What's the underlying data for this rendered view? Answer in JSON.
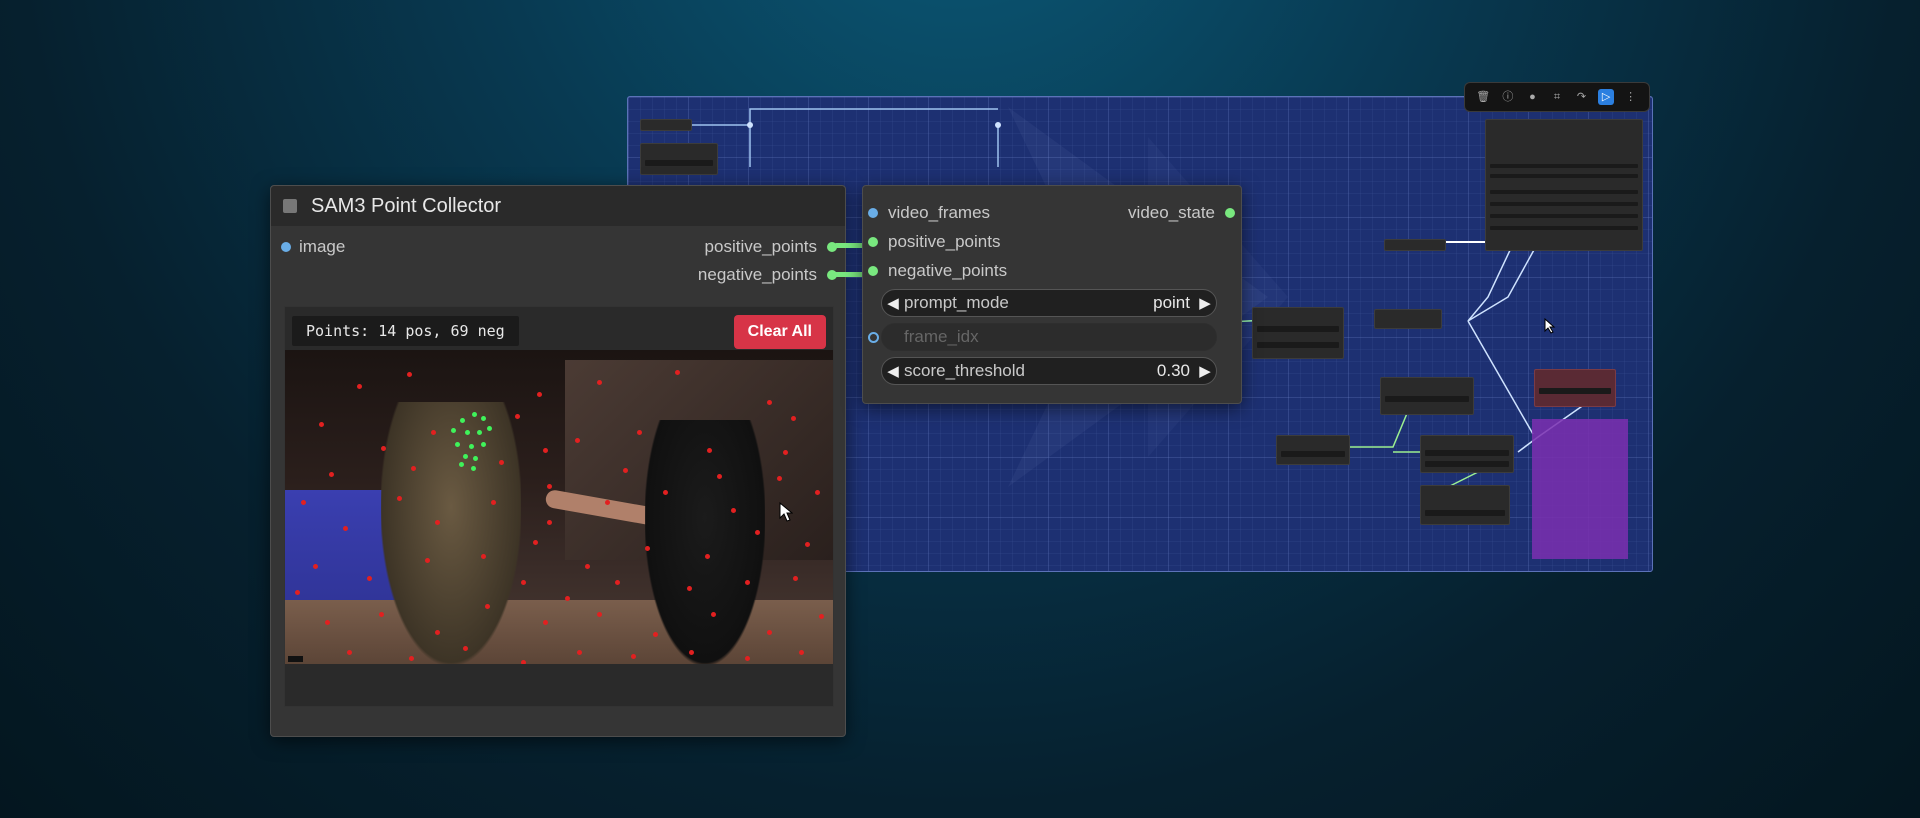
{
  "collector_node": {
    "title": "SAM3 Point Collector",
    "input_image": "image",
    "output_positive": "positive_points",
    "output_negative": "negative_points",
    "points_label": "Points: 14 pos, 69 neg",
    "clear_button": "Clear All"
  },
  "video_node": {
    "input_video_frames": "video_frames",
    "output_video_state": "video_state",
    "input_positive": "positive_points",
    "input_negative": "negative_points",
    "widgets": {
      "prompt_mode": {
        "label": "prompt_mode",
        "value": "point"
      },
      "frame_idx": {
        "label": "frame_idx"
      },
      "score_threshold": {
        "label": "score_threshold",
        "value": "0.30"
      }
    }
  },
  "toolbar": {
    "icons": [
      "trash-icon",
      "info-icon",
      "color-icon",
      "fit-icon",
      "redo-icon",
      "run-icon",
      "more-icon"
    ]
  },
  "colors": {
    "positive_point": "#3ff35a",
    "negative_point": "#e22020",
    "clear_button": "#d73447",
    "link_green": "#79e87f",
    "slot_blue": "#6aaee8"
  }
}
